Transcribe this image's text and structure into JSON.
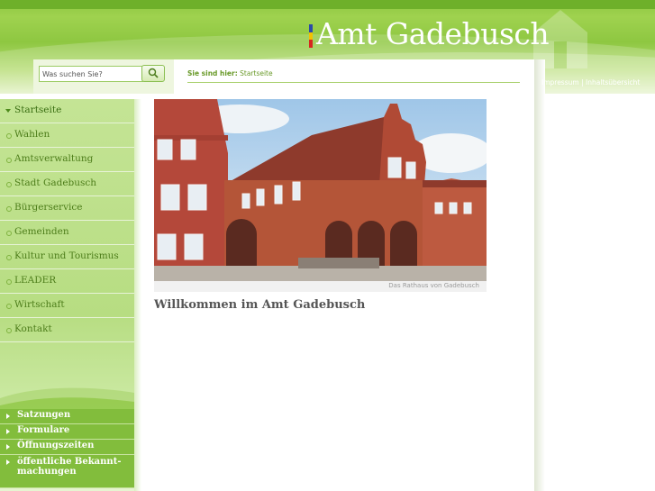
{
  "header": {
    "logo_text": "Amt Gadebusch",
    "logo_bar_colors": [
      "#2b4aa8",
      "#f2c200",
      "#d7261e"
    ],
    "links": {
      "impressum": "Impressum",
      "separator": "|",
      "inhaltsuebersicht": "Inhaltsübersicht"
    }
  },
  "search": {
    "placeholder": "Was suchen Sie?",
    "value": "Was suchen Sie?",
    "button_icon": "search-icon"
  },
  "breadcrumb": {
    "prefix": "Sie sind hier:",
    "current": "Startseite"
  },
  "sidebar": {
    "items": [
      {
        "label": "Startseite",
        "active": true
      },
      {
        "label": "Wahlen"
      },
      {
        "label": "Amtsverwaltung"
      },
      {
        "label": "Stadt Gadebusch"
      },
      {
        "label": "Bürgerservice"
      },
      {
        "label": "Gemeinden"
      },
      {
        "label": "Kultur und Tourismus"
      },
      {
        "label": "LEADER"
      },
      {
        "label": "Wirtschaft"
      },
      {
        "label": "Kontakt"
      }
    ],
    "quick_links": [
      {
        "label": "Satzungen"
      },
      {
        "label": "Formulare"
      },
      {
        "label": "Öffnungszeiten"
      },
      {
        "label": "öffentliche Bekannt- machungen"
      }
    ]
  },
  "main": {
    "image_caption": "Das Rathaus von Gadebusch",
    "heading": "Willkommen im Amt Gadebusch"
  },
  "colors": {
    "brand_green": "#8cc63f",
    "nav_text": "#4d7d1a",
    "quick_link_bg": "#82bd3c"
  }
}
